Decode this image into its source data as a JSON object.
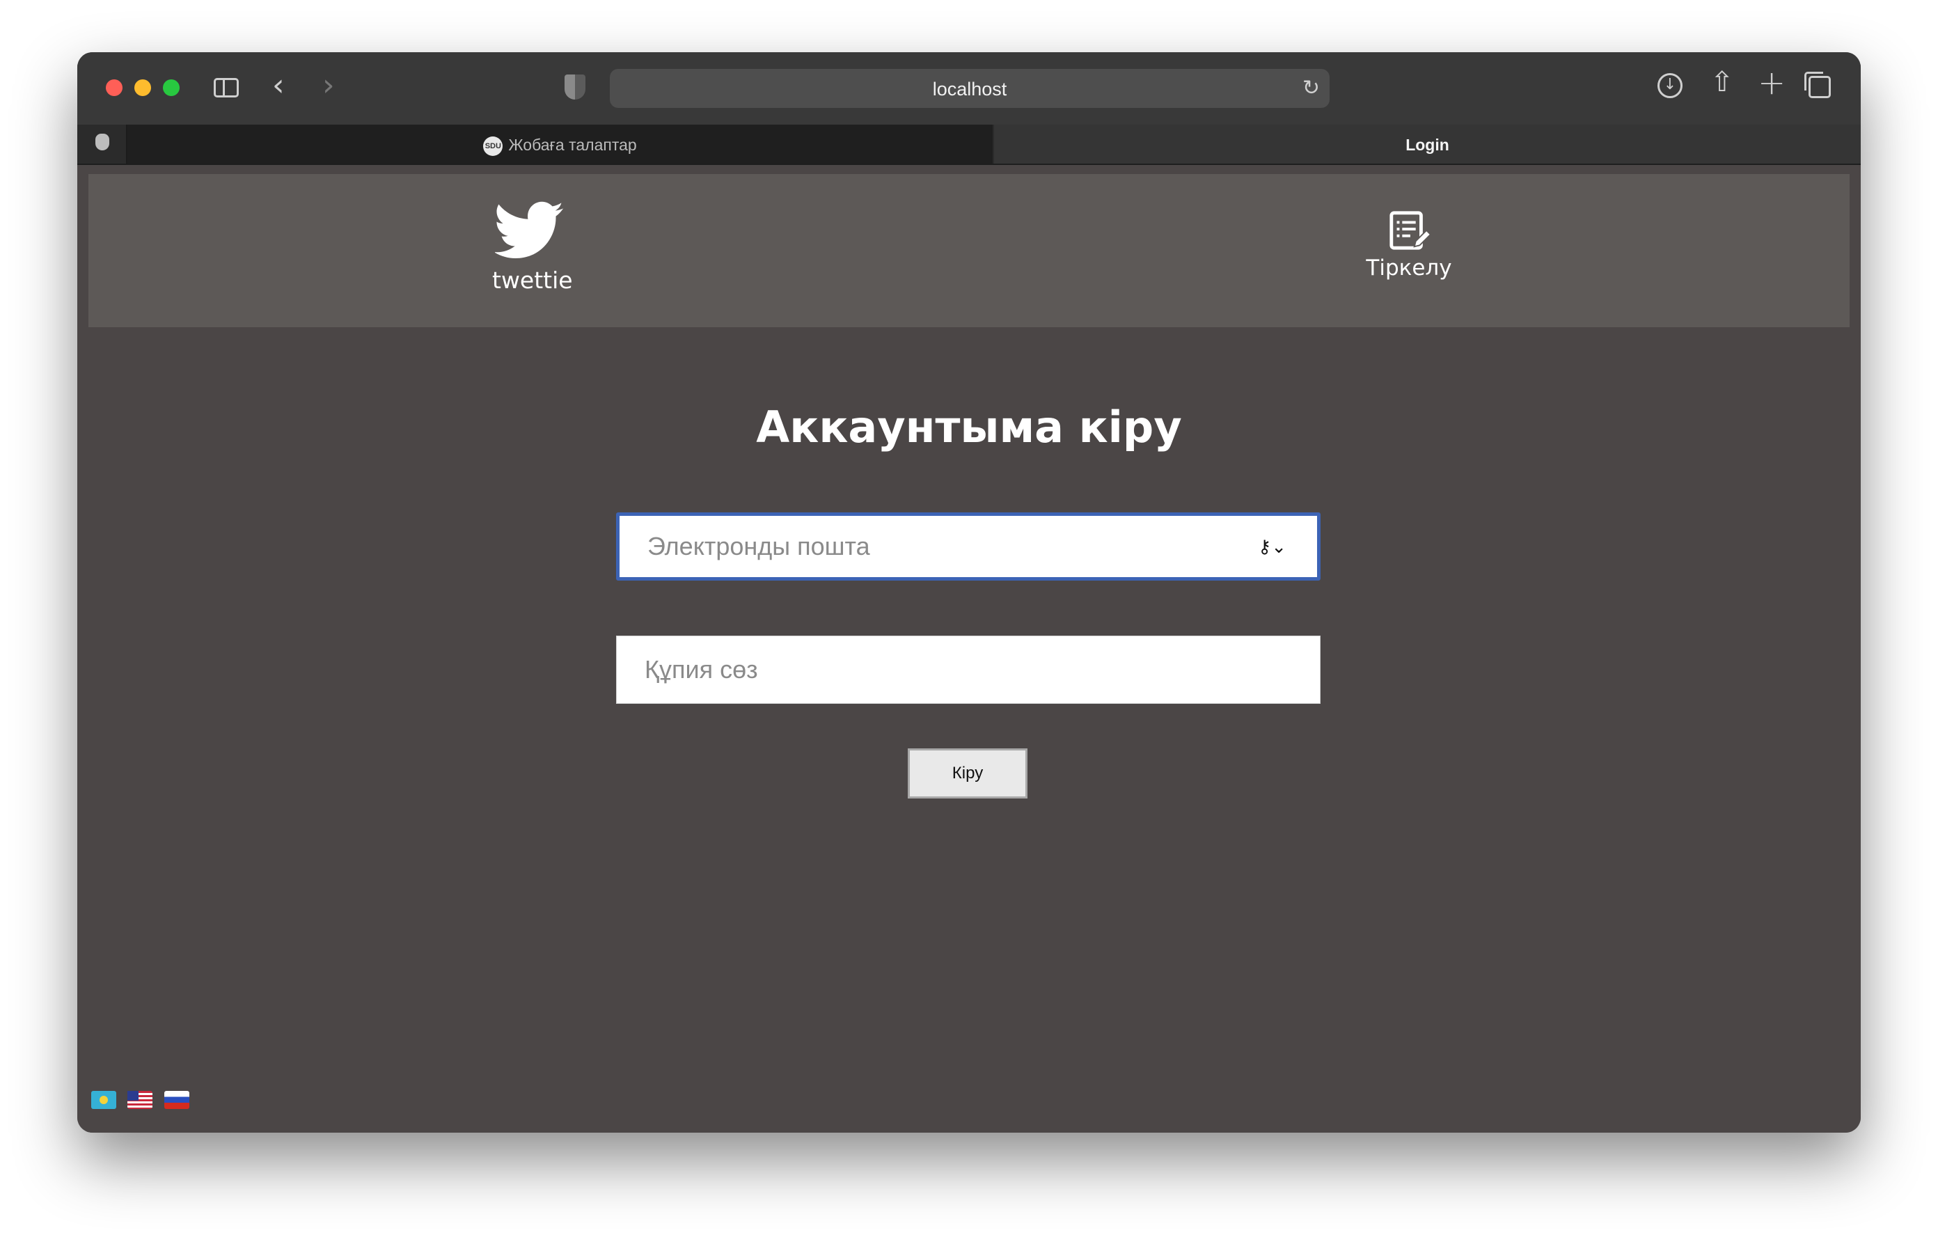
{
  "browser": {
    "url": "localhost",
    "tabs": [
      {
        "label": "Жобаға талаптар",
        "favicon": "SDU",
        "active": false
      },
      {
        "label": "Login",
        "active": true
      }
    ]
  },
  "header": {
    "brand_name": "twettie",
    "register_label": "Тіркелу"
  },
  "login": {
    "title": "Аккаунтыма кіру",
    "email_placeholder": "Электронды пошта",
    "password_placeholder": "Құпия сөз",
    "submit_label": "Кіру"
  },
  "languages": [
    "kz",
    "en",
    "ru"
  ],
  "colors": {
    "page_bg": "#4b4646",
    "header_bg": "#5d5957",
    "focus_border": "#3c63b5"
  }
}
